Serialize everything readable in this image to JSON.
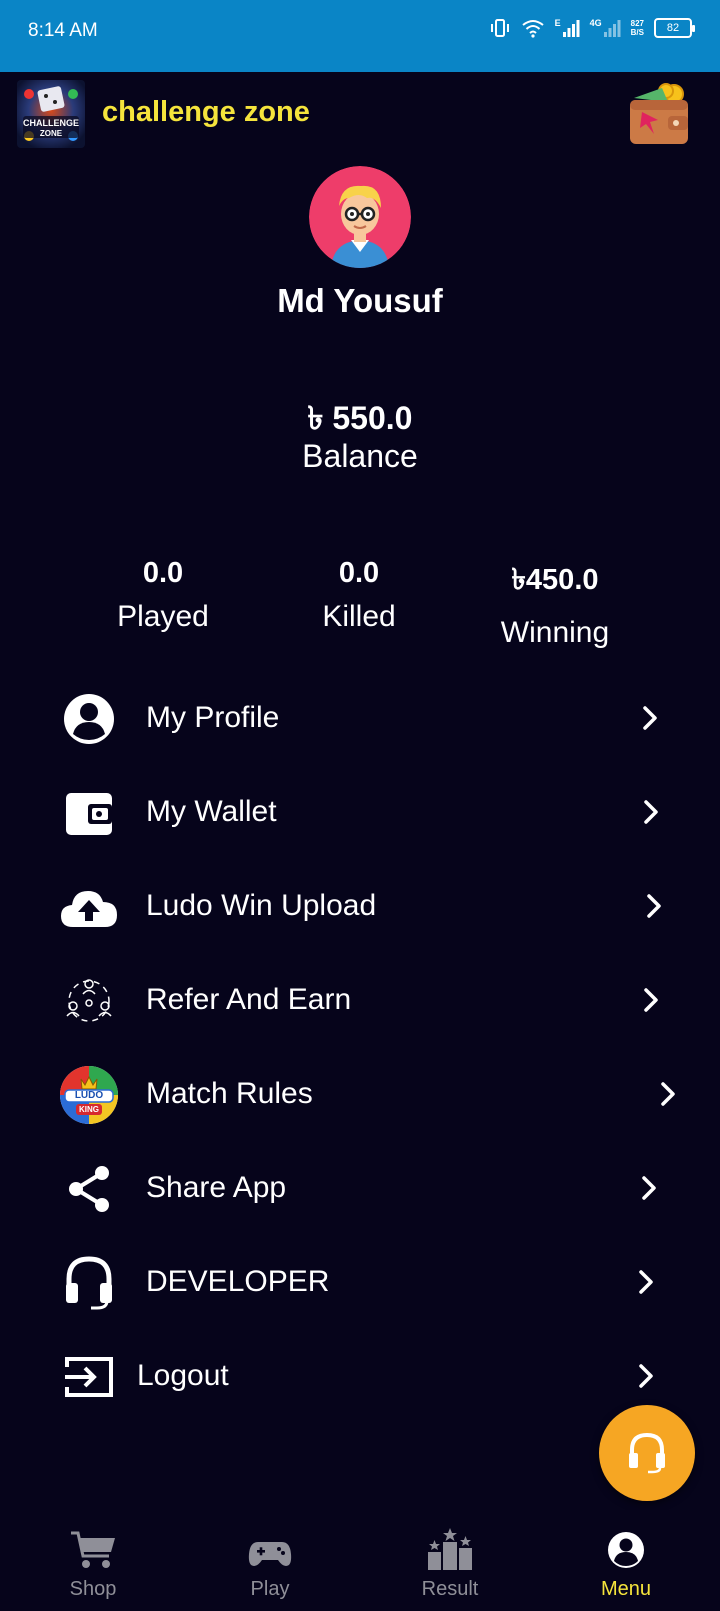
{
  "status_bar": {
    "time": "8:14 AM",
    "network_e": "E",
    "network_4g": "4G",
    "speed_value": "827",
    "speed_unit": "B/S",
    "battery": "82"
  },
  "header": {
    "logo_text_line1": "CHALLENGE",
    "logo_text_line2": "ZONE",
    "title": "challenge zone",
    "wallet_icon": "wallet-icon"
  },
  "profile": {
    "name": "Md Yousuf",
    "avatar_icon": "avatar-boy-glasses"
  },
  "balance": {
    "amount": "৳ 550.0",
    "label": "Balance"
  },
  "stats": [
    {
      "value": "0.0",
      "label": "Played"
    },
    {
      "value": "0.0",
      "label": "Killed"
    },
    {
      "value": "৳450.0",
      "label": "Winning"
    }
  ],
  "menu": [
    {
      "label": "My Profile",
      "icon": "user-circle-icon"
    },
    {
      "label": "My Wallet",
      "icon": "wallet-icon"
    },
    {
      "label": "Ludo Win Upload",
      "icon": "cloud-upload-icon"
    },
    {
      "label": "Refer And Earn",
      "icon": "people-network-icon"
    },
    {
      "label": "Match Rules",
      "icon": "ludo-king-icon",
      "badge_text_top": "LUDO",
      "badge_text_bottom": "KING"
    },
    {
      "label": "Share App",
      "icon": "share-icon"
    },
    {
      "label": "DEVELOPER",
      "icon": "headphones-icon"
    },
    {
      "label": "Logout",
      "icon": "logout-icon"
    }
  ],
  "bottom_nav": [
    {
      "label": "Shop",
      "icon": "cart-icon",
      "active": false
    },
    {
      "label": "Play",
      "icon": "gamepad-icon",
      "active": false
    },
    {
      "label": "Result",
      "icon": "leaderboard-icon",
      "active": false
    },
    {
      "label": "Menu",
      "icon": "user-circle-icon",
      "active": true
    }
  ],
  "colors": {
    "background": "#06041b",
    "status_bar": "#0a85c6",
    "accent_yellow": "#f5e43c",
    "fab": "#f6a623",
    "nav_inactive": "#8f8f98"
  }
}
